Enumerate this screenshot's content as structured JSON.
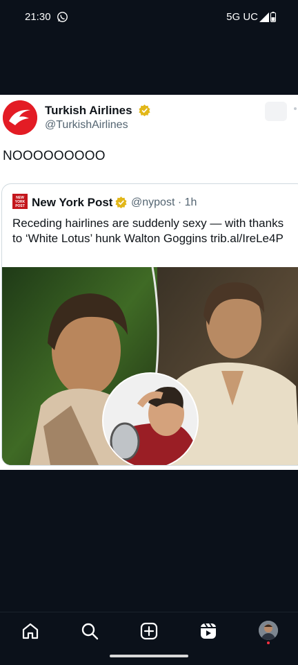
{
  "status_bar": {
    "time": "21:30",
    "network": "5G UC"
  },
  "tweet": {
    "author_name": "Turkish Airlines",
    "author_handle": "@TurkishAirlines",
    "text": "NOOOOOOOOO"
  },
  "quoted_tweet": {
    "author_name": "New York Post",
    "logo_text": "NEW YORK POST",
    "handle_time": "@nypost · 1h",
    "text": "Receding hairlines are suddenly sexy — with thanks to ‘White Lotus’ hunk Walton Goggins trib.al/IreLe4P"
  },
  "colors": {
    "accent_red": "#e31c25",
    "verified_gold": "#e2b719",
    "background": "#0b111a"
  },
  "bottom_nav": {
    "items": [
      "home-icon",
      "search-icon",
      "create-icon",
      "reels-icon",
      "profile-avatar"
    ]
  }
}
